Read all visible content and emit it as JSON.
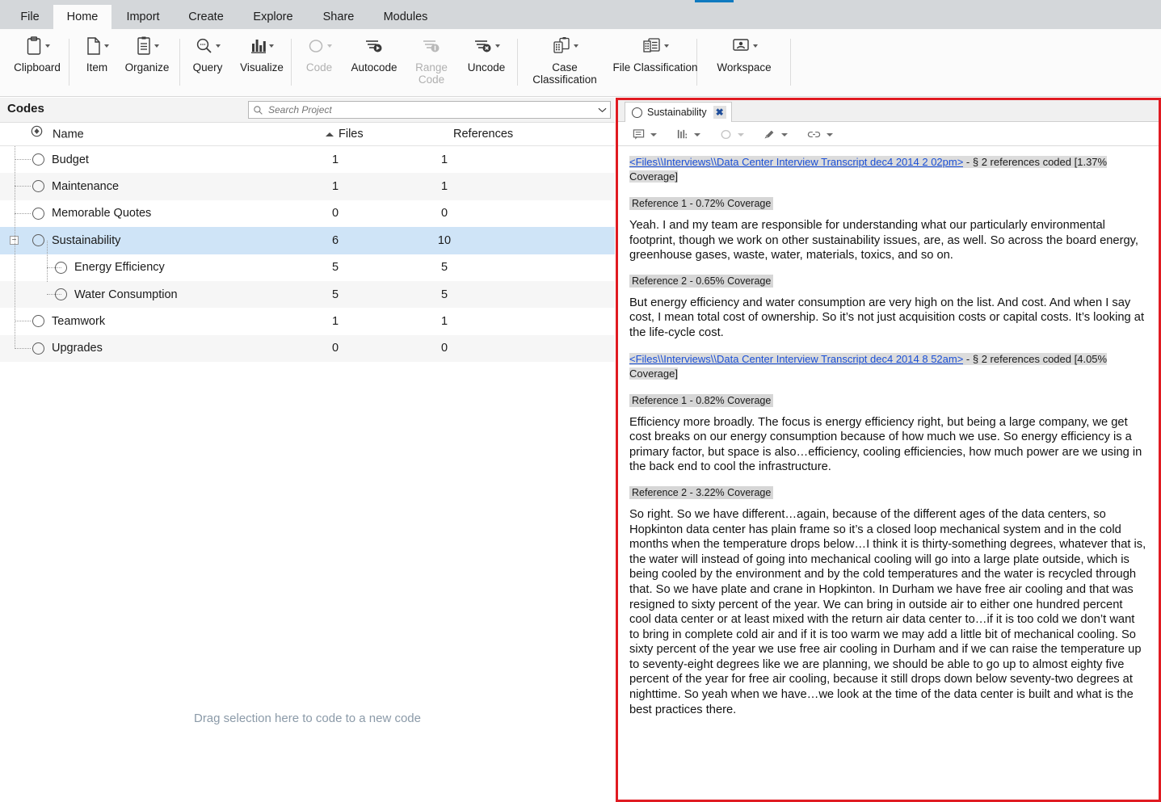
{
  "ribbon": {
    "tabs": [
      {
        "label": "File"
      },
      {
        "label": "Home"
      },
      {
        "label": "Import"
      },
      {
        "label": "Create"
      },
      {
        "label": "Explore"
      },
      {
        "label": "Share"
      },
      {
        "label": "Modules"
      }
    ],
    "active_tab": "Home",
    "buttons": [
      {
        "label": "Clipboard",
        "icon": "clipboard-icon",
        "enabled": true,
        "has_caret": true
      },
      {
        "label": "Item",
        "icon": "document-icon",
        "enabled": true,
        "has_caret": true
      },
      {
        "label": "Organize",
        "icon": "list-panel-icon",
        "enabled": true,
        "has_caret": true
      },
      {
        "label": "Query",
        "icon": "magnifier-icon",
        "enabled": true,
        "has_caret": true
      },
      {
        "label": "Visualize",
        "icon": "bar-chart-icon",
        "enabled": true,
        "has_caret": true
      },
      {
        "label": "Code",
        "icon": "circle-code-icon",
        "enabled": false,
        "has_caret": true
      },
      {
        "label": "Autocode",
        "icon": "autocode-icon",
        "enabled": true,
        "has_caret": false
      },
      {
        "label": "Range Code",
        "icon": "range-code-icon",
        "enabled": false,
        "has_caret": false
      },
      {
        "label": "Uncode",
        "icon": "uncode-icon",
        "enabled": true,
        "has_caret": true
      },
      {
        "label": "Case Classification",
        "icon": "case-classification-icon",
        "enabled": true,
        "has_caret": true
      },
      {
        "label": "File Classification",
        "icon": "file-classification-icon",
        "enabled": true,
        "has_caret": true
      },
      {
        "label": "Workspace",
        "icon": "workspace-icon",
        "enabled": true,
        "has_caret": true
      }
    ]
  },
  "codes_pane": {
    "title": "Codes",
    "search": {
      "placeholder": "Search Project",
      "value": "",
      "icon": "search-icon",
      "dropdown_icon": "chevron-down-icon"
    },
    "columns": {
      "name": "Name",
      "files": "Files",
      "references": "References"
    },
    "sorted_column": "Files",
    "sort_direction": "ascending",
    "rows": [
      {
        "name": "Budget",
        "files": "1",
        "references": "1",
        "level": 1,
        "selected": false,
        "expandable": false
      },
      {
        "name": "Maintenance",
        "files": "1",
        "references": "1",
        "level": 1,
        "selected": false,
        "expandable": false
      },
      {
        "name": "Memorable Quotes",
        "files": "0",
        "references": "0",
        "level": 1,
        "selected": false,
        "expandable": false
      },
      {
        "name": "Sustainability",
        "files": "6",
        "references": "10",
        "level": 1,
        "selected": true,
        "expandable": true,
        "expanded": true
      },
      {
        "name": "Energy Efficiency",
        "files": "5",
        "references": "5",
        "level": 2,
        "selected": false,
        "expandable": false
      },
      {
        "name": "Water Consumption",
        "files": "5",
        "references": "5",
        "level": 2,
        "selected": false,
        "expandable": false
      },
      {
        "name": "Teamwork",
        "files": "1",
        "references": "1",
        "level": 1,
        "selected": false,
        "expandable": false
      },
      {
        "name": "Upgrades",
        "files": "0",
        "references": "0",
        "level": 1,
        "selected": false,
        "expandable": false
      }
    ],
    "dropzone_text": "Drag selection here to code to a new code"
  },
  "detail_pane": {
    "highlight_color": "#e01b22",
    "tab": {
      "label": "Sustainability",
      "icon": "code-circle-icon",
      "close_label": "✖"
    },
    "toolbar": [
      {
        "name": "annotations-icon",
        "enabled": true
      },
      {
        "name": "coding-stripes-icon",
        "enabled": true
      },
      {
        "name": "code-circle-icon",
        "enabled": false
      },
      {
        "name": "highlight-pen-icon",
        "enabled": true
      },
      {
        "name": "link-icon",
        "enabled": true
      }
    ],
    "sources": [
      {
        "link": "<Files\\\\Interviews\\\\Data Center Interview Transcript dec4 2014 2 02pm>",
        "meta": " - § 2 references coded  [1.37% Coverage]",
        "references": [
          {
            "header": "Reference 1 - 0.72% Coverage",
            "text": "Yeah.  I and my team are responsible for understanding what our particularly environmental footprint, though we work on other sustainability issues, are, as well.  So across the board energy, greenhouse gases, waste, water, materials, toxics, and so on."
          },
          {
            "header": "Reference 2 - 0.65% Coverage",
            "text": "But energy efficiency and water consumption are very high on the list.  And cost.  And when I say cost, I mean total cost of ownership.  So it’s not just acquisition costs or capital costs.  It’s looking at the life-cycle cost."
          }
        ]
      },
      {
        "link": "<Files\\\\Interviews\\\\Data Center Interview Transcript dec4 2014 8 52am>",
        "meta": " - § 2 references coded  [4.05% Coverage]",
        "references": [
          {
            "header": "Reference 1 - 0.82% Coverage",
            "text": " Efficiency more broadly.  The focus is energy efficiency right, but being a large company, we get cost breaks on our energy consumption because of how much we use.  So energy efficiency is a primary factor, but space is also…efficiency, cooling efficiencies, how much power are we using in the back end to cool the infrastructure."
          },
          {
            "header": "Reference 2 - 3.22% Coverage",
            "text": "So right.  So we have different…again, because of the different ages of the data centers, so Hopkinton data center has plain frame so it’s a closed loop mechanical system and in the cold months when the temperature drops below…I think it is thirty-something degrees, whatever that is, the water will instead of going into mechanical cooling will go into a large plate outside, which is being cooled by the environment and by the cold temperatures and the water is recycled through that.  So we have plate and crane in Hopkinton.  In Durham we have free air cooling and that was resigned to sixty percent of the year.  We can bring in outside air to either one hundred percent cool data center or at least mixed with the return air data center to…if it is too cold we don’t want to bring in complete cold air and if it is too warm we may add a little bit of mechanical cooling.  So sixty percent of the year we use free air cooling in Durham and if we can raise the temperature up to seventy-eight degrees like we are planning, we should be able to go up to almost eighty five percent of the year for free air cooling, because it still drops down below seventy-two degrees at nighttime.  So yeah when we have…we look at the time of the data center is built and what is the best practices there."
          }
        ]
      }
    ]
  }
}
